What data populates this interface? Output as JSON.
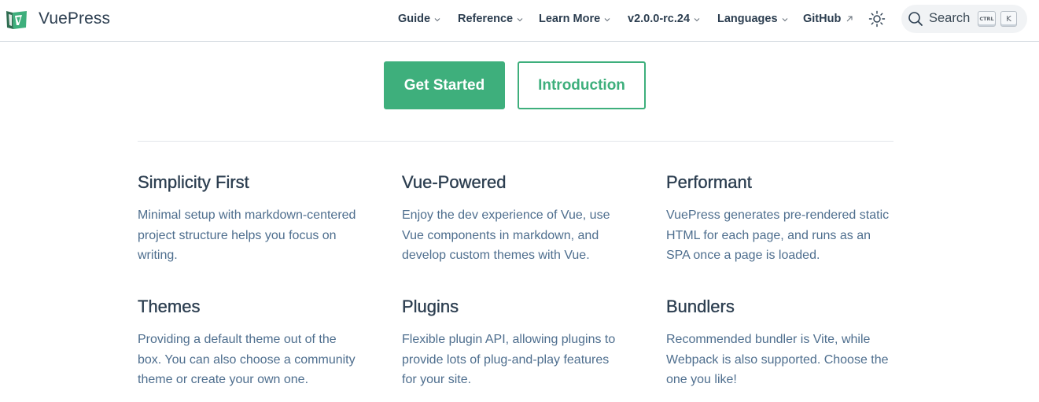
{
  "navbar": {
    "site_name": "VuePress",
    "items": [
      {
        "label": "Guide",
        "dropdown": true
      },
      {
        "label": "Reference",
        "dropdown": true
      },
      {
        "label": "Learn More",
        "dropdown": true
      },
      {
        "label": "v2.0.0-rc.24",
        "dropdown": true
      },
      {
        "label": "Languages",
        "dropdown": true
      },
      {
        "label": "GitHub",
        "external": true
      }
    ],
    "search": {
      "label": "Search",
      "key_ctrl": "CTRL",
      "key_k": "K"
    }
  },
  "hero": {
    "primary_action": "Get Started",
    "secondary_action": "Introduction"
  },
  "features": [
    {
      "title": "Simplicity First",
      "details": "Minimal setup with markdown-centered project structure helps you focus on writing."
    },
    {
      "title": "Vue-Powered",
      "details": "Enjoy the dev experience of Vue, use Vue components in markdown, and develop custom themes with Vue."
    },
    {
      "title": "Performant",
      "details": "VuePress generates pre-rendered static HTML for each page, and runs as an SPA once a page is loaded."
    },
    {
      "title": "Themes",
      "details": "Providing a default theme out of the box. You can also choose a community theme or create your own one."
    },
    {
      "title": "Plugins",
      "details": "Flexible plugin API, allowing plugins to provide lots of plug-and-play features for your site."
    },
    {
      "title": "Bundlers",
      "details": "Recommended bundler is Vite, while Webpack is also supported. Choose the one you like!"
    }
  ],
  "colors": {
    "accent": "#3eaf7c",
    "text": "#2c3e50",
    "muted_text": "#4e6e8e"
  },
  "icons": [
    "vuepress-logo",
    "chevron-down-icon",
    "external-link-icon",
    "sun-icon",
    "search-icon"
  ]
}
